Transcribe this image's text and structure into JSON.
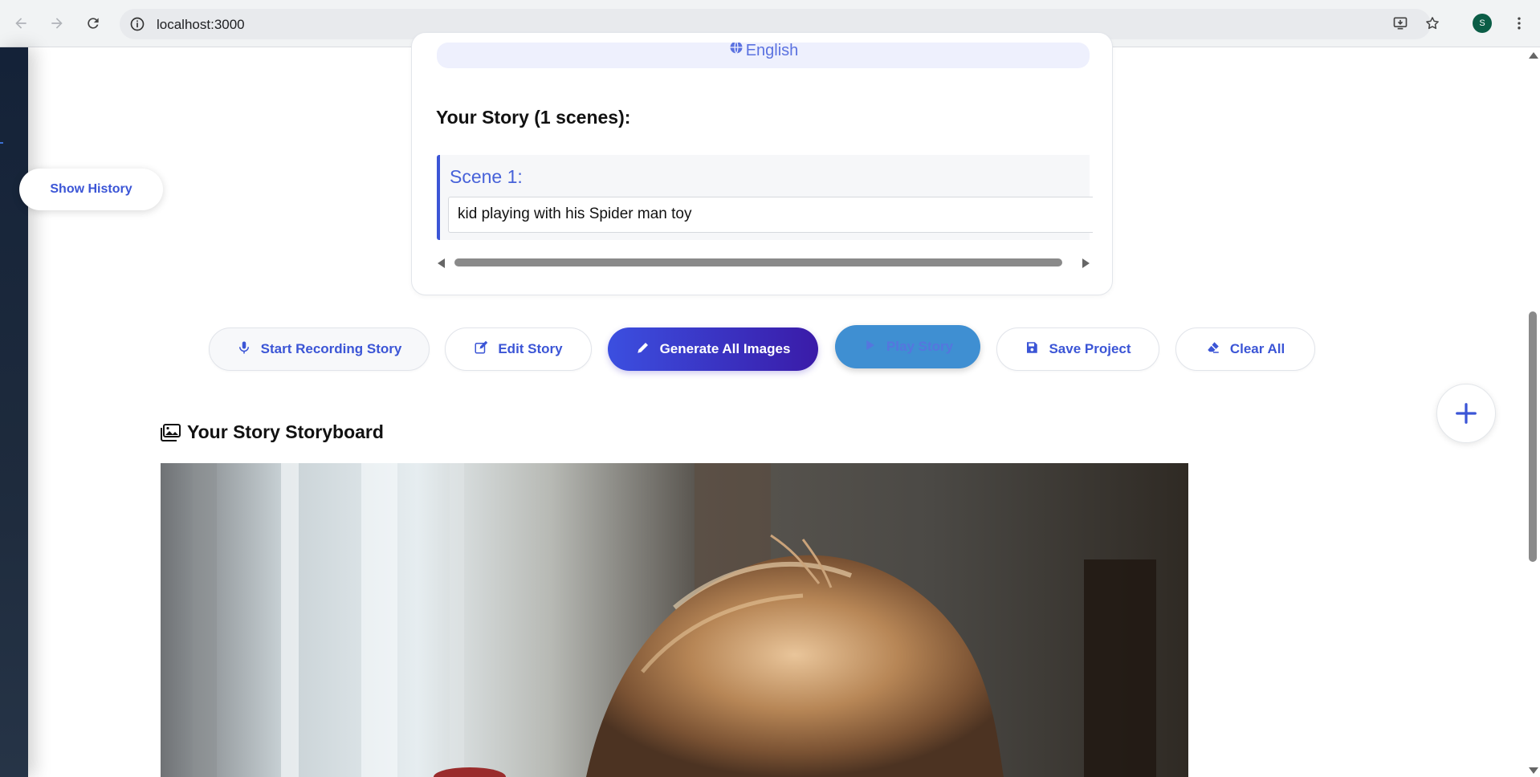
{
  "browser": {
    "url": "localhost:3000",
    "profile_initial": "S",
    "icons": [
      "back-icon",
      "forward-icon",
      "reload-icon",
      "info-icon",
      "install-app-icon",
      "bookmark-star-icon",
      "more-vert-icon"
    ]
  },
  "sidebar": {
    "show_history_label": "Show History"
  },
  "story": {
    "language_label": "English",
    "heading": "Your Story (1 scenes):",
    "scenes": [
      {
        "label": "Scene 1:",
        "text": "kid playing with his Spider man toy"
      }
    ]
  },
  "actions": {
    "record_label": "Start Recording Story",
    "edit_label": "Edit Story",
    "generate_label": "Generate All Images",
    "play_label": "Play Story",
    "save_label": "Save Project",
    "clear_label": "Clear All"
  },
  "storyboard": {
    "title": "Your Story Storyboard"
  },
  "colors": {
    "accent": "#3b55d6",
    "generate_gradient_start": "#3b4fe0",
    "generate_gradient_end": "#3a1ba8",
    "play_button": "#3f8fd2",
    "sidebar": "#1e2b3d",
    "language_pill": "#eef0fd"
  }
}
